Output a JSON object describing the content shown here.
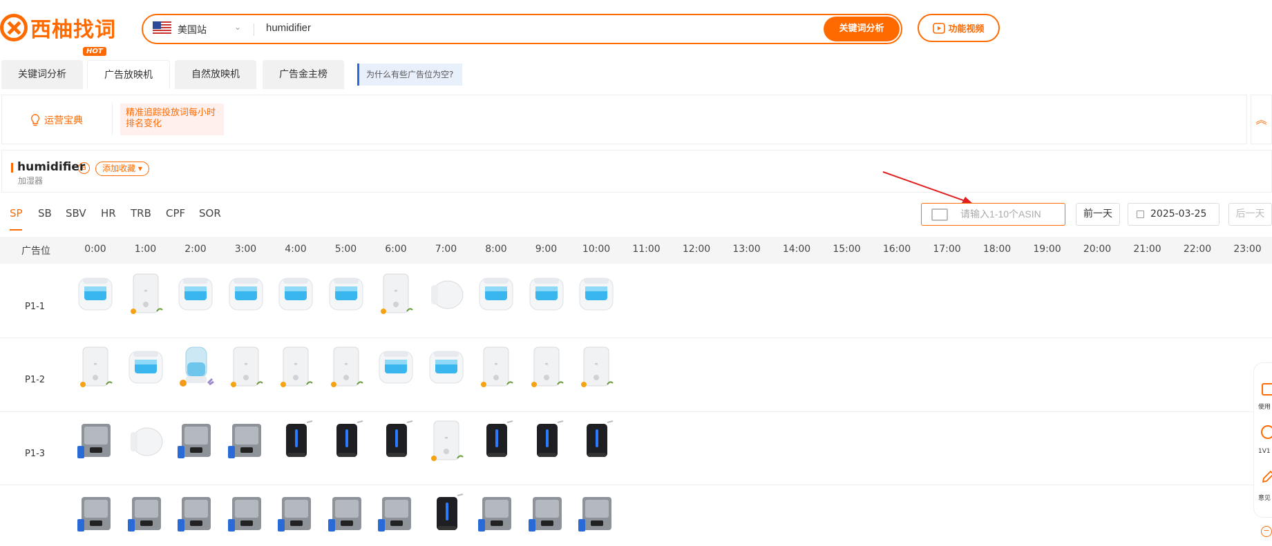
{
  "app": {
    "logo_text": "西柚找词"
  },
  "search": {
    "site": "美国站",
    "query": "humidifier",
    "button_label": "关键词分析"
  },
  "video_button": {
    "label": "功能视频"
  },
  "tabs": [
    {
      "label": "关键词分析"
    },
    {
      "label": "广告放映机",
      "badge": "HOT",
      "active": true
    },
    {
      "label": "自然放映机"
    },
    {
      "label": "广告金主榜"
    }
  ],
  "why_notice": "为什么有些广告位为空?",
  "tips": {
    "button_label": "运营宝典",
    "note": "精准追踪投放词每小时排名变化"
  },
  "keyword": {
    "title": "humidifier",
    "favorite_label": "添加收藏",
    "translation": "加湿器"
  },
  "subtabs": [
    "SP",
    "SB",
    "SBV",
    "HR",
    "TRB",
    "CPF",
    "SOR"
  ],
  "asin_input": {
    "placeholder": "请输入1-10个ASIN"
  },
  "date_nav": {
    "prev_label": "前一天",
    "date": "2025-03-25",
    "next_label": "后一天"
  },
  "table": {
    "position_header": "广告位",
    "hours": [
      "0:00",
      "1:00",
      "2:00",
      "3:00",
      "4:00",
      "5:00",
      "6:00",
      "7:00",
      "8:00",
      "9:00",
      "10:00",
      "11:00",
      "12:00",
      "13:00",
      "14:00",
      "15:00",
      "16:00",
      "17:00",
      "18:00",
      "19:00",
      "20:00",
      "21:00",
      "22:00",
      "23:00"
    ],
    "rows": [
      {
        "label": "P1-1",
        "products": [
          "humidifier-white-blue-tank",
          "humidifier-white-tower",
          "humidifier-white-blue-tank",
          "humidifier-white-blue-tank",
          "humidifier-white-blue-tank",
          "humidifier-white-blue-tank",
          "humidifier-white-tower",
          "humidifier-white-round",
          "humidifier-white-blue-tank",
          "humidifier-white-blue-tank",
          "humidifier-white-blue-tank"
        ]
      },
      {
        "label": "P1-2",
        "products": [
          "humidifier-white-tower",
          "humidifier-white-blue-tank",
          "humidifier-clear-blue-lavender",
          "humidifier-white-tower",
          "humidifier-white-tower",
          "humidifier-white-tower",
          "humidifier-white-blue-tank",
          "humidifier-white-blue-tank",
          "humidifier-white-tower",
          "humidifier-white-tower",
          "humidifier-white-tower"
        ]
      },
      {
        "label": "P1-3",
        "products": [
          "humidifier-gray-large",
          "humidifier-white-round",
          "humidifier-gray-large",
          "humidifier-gray-large",
          "humidifier-black-tower",
          "humidifier-black-tower",
          "humidifier-black-tower",
          "humidifier-white-tower",
          "humidifier-black-tower",
          "humidifier-black-tower",
          "humidifier-black-tower"
        ]
      },
      {
        "label": "",
        "products": [
          "humidifier-gray-large",
          "humidifier-gray-large",
          "humidifier-gray-large",
          "humidifier-gray-large",
          "humidifier-gray-large",
          "humidifier-gray-large",
          "humidifier-gray-large",
          "humidifier-black-tower",
          "humidifier-gray-large",
          "humidifier-gray-large",
          "humidifier-gray-large"
        ]
      }
    ]
  },
  "side_widget": {
    "items": [
      "使用",
      "1V1",
      "意见"
    ]
  },
  "colors": {
    "accent": "#ff6a00",
    "notice_blue": "#2a6ad6"
  }
}
